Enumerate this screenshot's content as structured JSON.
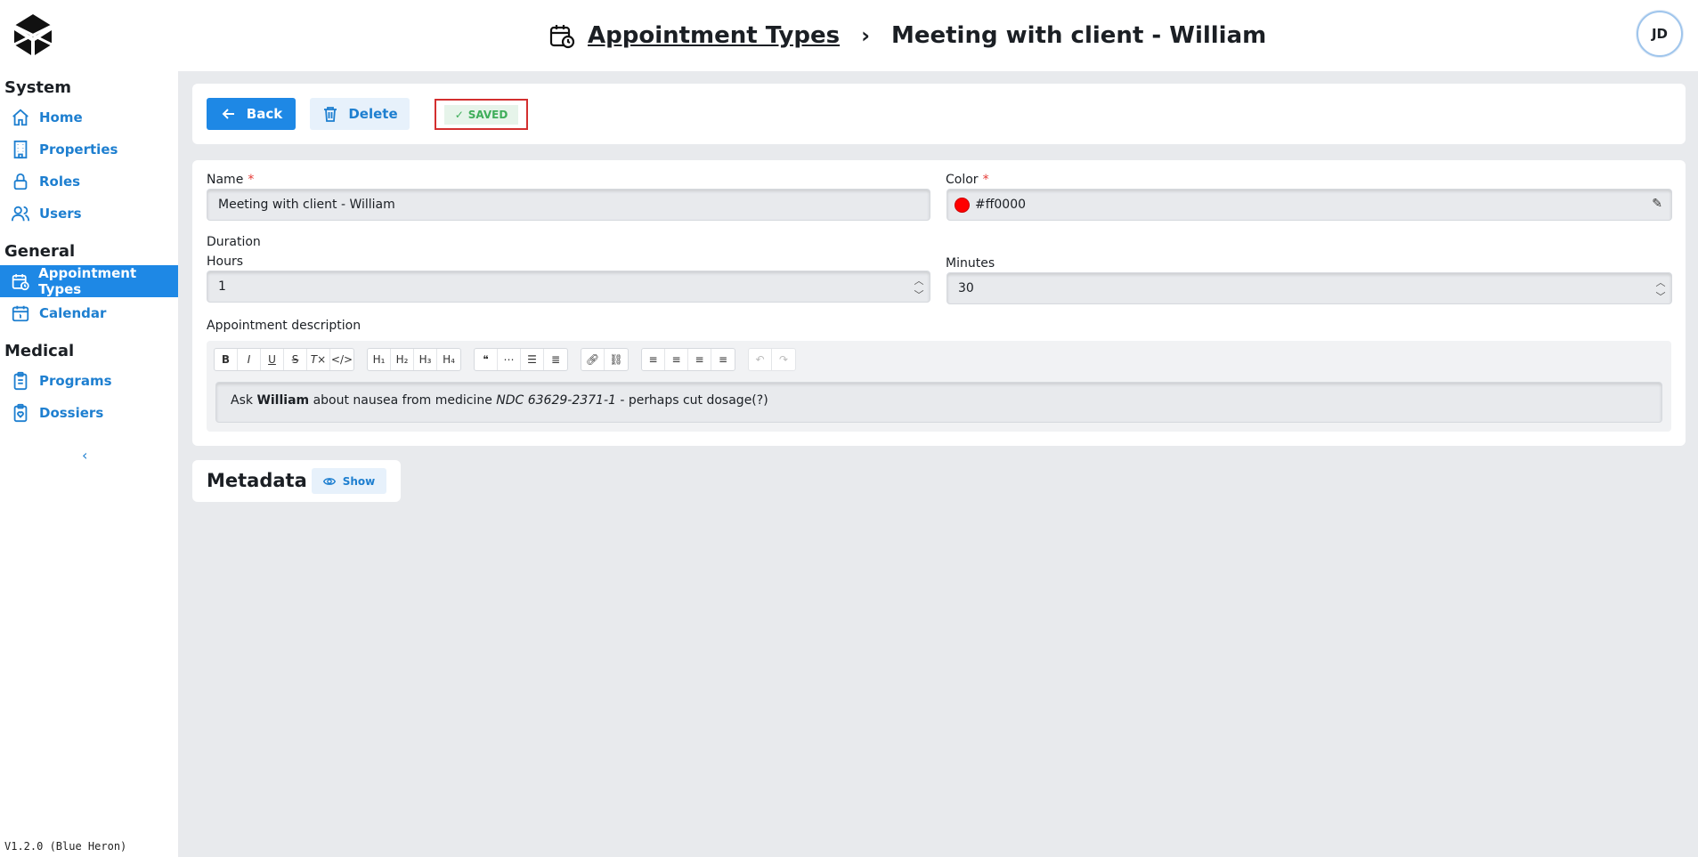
{
  "header": {
    "breadcrumb_link": "Appointment Types",
    "breadcrumb_separator": "›",
    "breadcrumb_current": "Meeting with client - William",
    "avatar_initials": "JD"
  },
  "sidebar": {
    "sections": [
      {
        "title": "System",
        "items": [
          "Home",
          "Properties",
          "Roles",
          "Users"
        ]
      },
      {
        "title": "General",
        "items": [
          "Appointment Types",
          "Calendar"
        ]
      },
      {
        "title": "Medical",
        "items": [
          "Programs",
          "Dossiers"
        ]
      }
    ],
    "active_item": "Appointment Types",
    "version": "V1.2.0 (Blue Heron)"
  },
  "actions": {
    "back_label": "Back",
    "delete_label": "Delete",
    "saved_label": "SAVED"
  },
  "form": {
    "name_label": "Name",
    "name_value": "Meeting with client - William",
    "required_mark": "*",
    "color_label": "Color",
    "color_value": "#ff0000",
    "duration_label": "Duration",
    "hours_label": "Hours",
    "hours_value": "1",
    "minutes_label": "Minutes",
    "minutes_value": "30",
    "description_label": "Appointment description",
    "description": {
      "part1": "Ask ",
      "bold": "William",
      "part2": " about nausea from medicine ",
      "italic": "NDC 63629-2371-1",
      "part3": " - perhaps cut dosage(?)"
    }
  },
  "metadata": {
    "title": "Metadata",
    "show_label": "Show"
  },
  "colors": {
    "accent": "#1e88e5",
    "saved_green": "#3fae5a",
    "highlight_border": "#d32f2f",
    "background": "#e8eaed"
  }
}
